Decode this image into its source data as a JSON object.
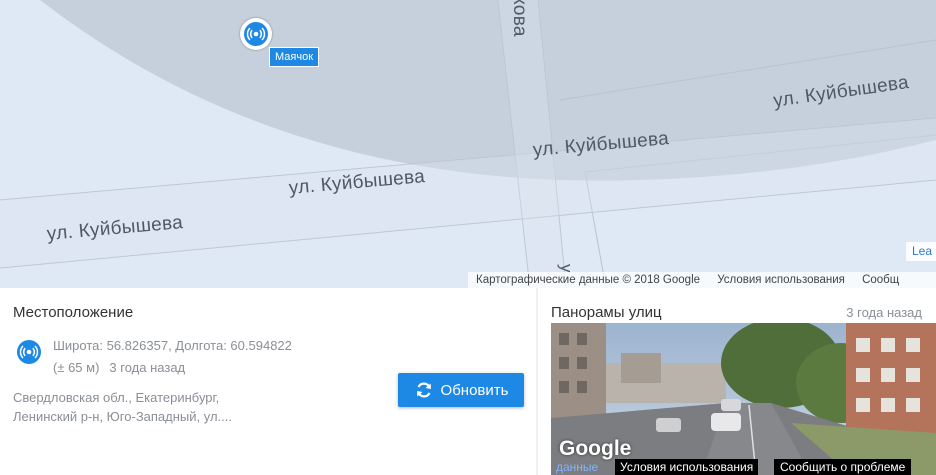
{
  "map": {
    "streets": [
      "ул. Куйбышева",
      "ул. Куйбышева",
      "ул. Куйбышева",
      "ул. Куйбышева"
    ],
    "street_partial_top": "кова",
    "street_partial_bottom": "у",
    "marker_label": "Маячок",
    "leaflet_attribution": "Lea",
    "google_data": "Картографические данные © 2018 Google",
    "google_terms": "Условия использования",
    "google_report": "Сообщ",
    "colors": {
      "accent": "#1e88e5",
      "accuracy_zone": "#c4cfdb",
      "map_bg": "#dfe9f5"
    }
  },
  "location": {
    "title": "Местоположение",
    "coordinates": "Широта: 56.826357, Долгота: 60.594822",
    "accuracy": "(± 65 м)",
    "time_ago": "3 года назад",
    "address_line1": "Свердловская обл., Екатеринбург,",
    "address_line2": "Ленинский р-н, Юго-Западный, ул....",
    "refresh_label": "Обновить"
  },
  "panorama": {
    "title": "Панорамы улиц",
    "time_ago": "3 года назад",
    "logo": "Google",
    "data_label": "данные",
    "terms_label": "Условия использования",
    "report_label": "Сообщить о проблеме"
  },
  "icons": {
    "marker": "beacon-icon",
    "location": "beacon-icon",
    "refresh": "refresh-icon"
  }
}
